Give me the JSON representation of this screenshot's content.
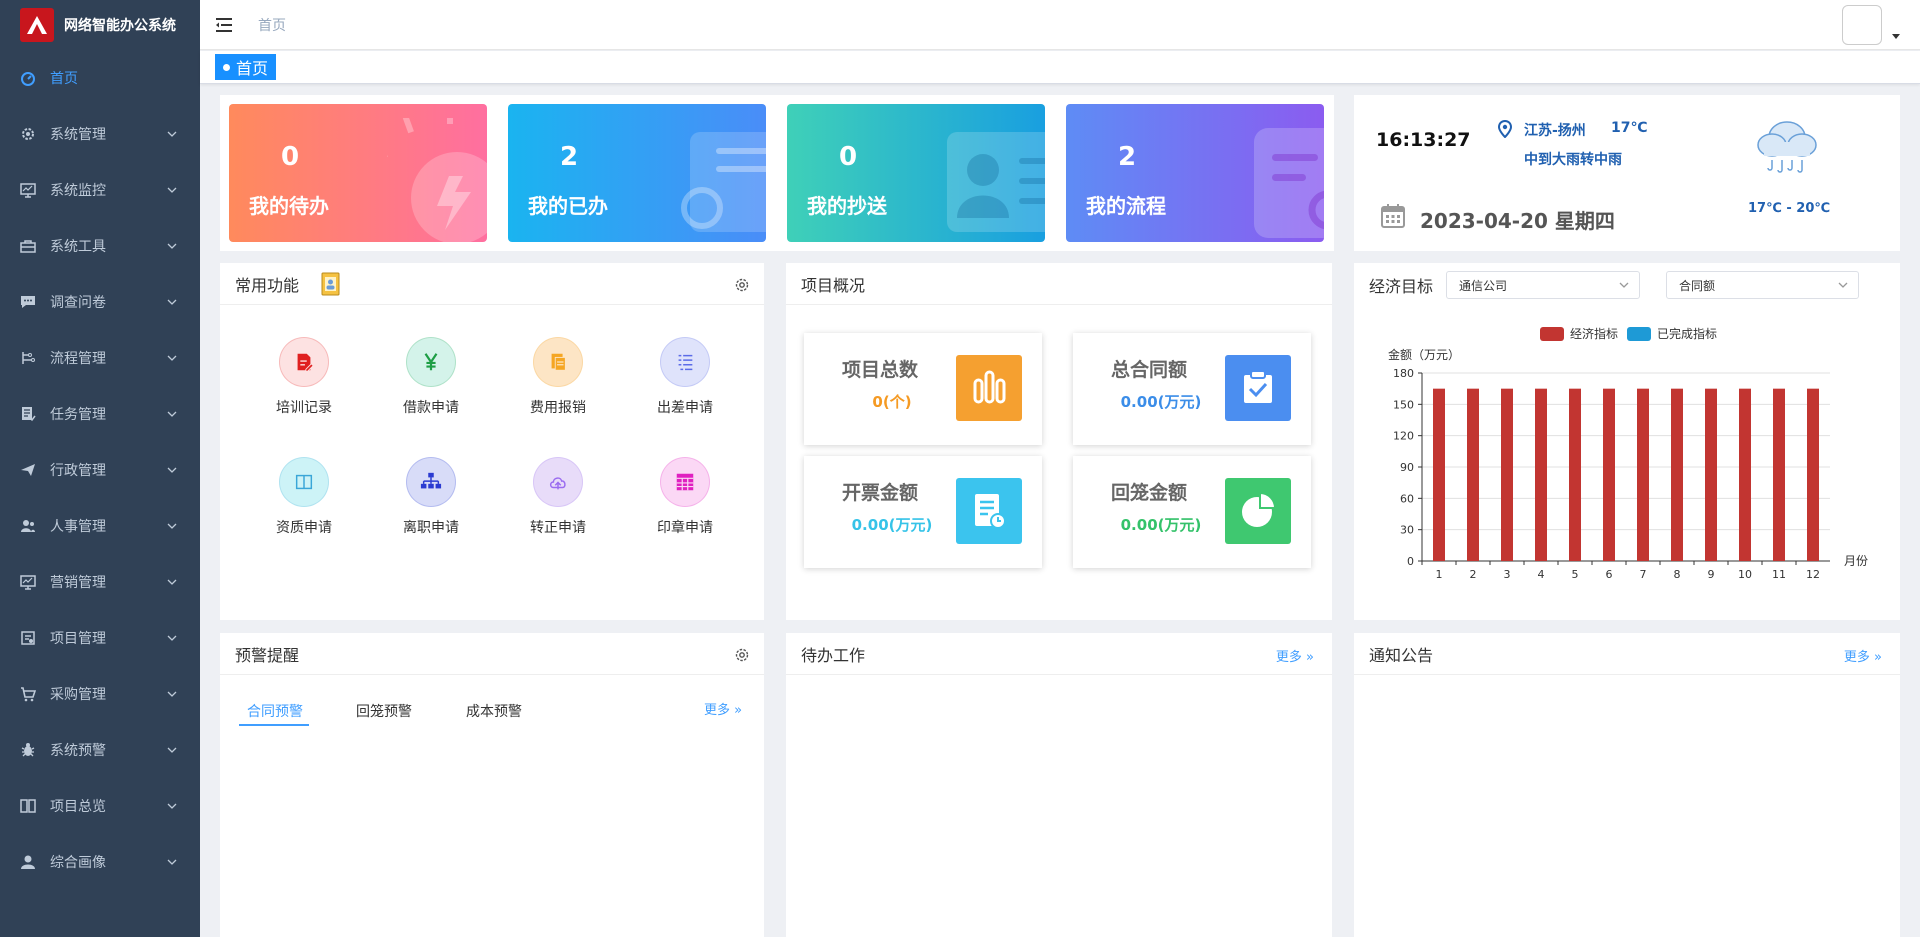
{
  "app": {
    "title": "网络智能办公系统"
  },
  "sidebar": {
    "items": [
      {
        "label": "首页",
        "icon": "dashboard-icon",
        "active": true
      },
      {
        "label": "系统管理",
        "icon": "gear-icon"
      },
      {
        "label": "系统监控",
        "icon": "monitor-icon"
      },
      {
        "label": "系统工具",
        "icon": "toolbox-icon"
      },
      {
        "label": "调查问卷",
        "icon": "chat-icon"
      },
      {
        "label": "流程管理",
        "icon": "flow-icon"
      },
      {
        "label": "任务管理",
        "icon": "task-icon"
      },
      {
        "label": "行政管理",
        "icon": "send-icon"
      },
      {
        "label": "人事管理",
        "icon": "people-icon"
      },
      {
        "label": "营销管理",
        "icon": "chart-icon"
      },
      {
        "label": "项目管理",
        "icon": "project-icon"
      },
      {
        "label": "采购管理",
        "icon": "cart-icon"
      },
      {
        "label": "系统预警",
        "icon": "bug-icon"
      },
      {
        "label": "项目总览",
        "icon": "book-icon"
      },
      {
        "label": "综合画像",
        "icon": "user-icon"
      }
    ]
  },
  "header": {
    "breadcrumb": "首页"
  },
  "tags": {
    "home": "首页"
  },
  "stats": [
    {
      "value": "0",
      "label": "我的待办",
      "color_from": "#ff8a5c",
      "color_to": "#ff6fa0"
    },
    {
      "value": "2",
      "label": "我的已办",
      "color_from": "#1ab4f0",
      "color_to": "#4a8df8"
    },
    {
      "value": "0",
      "label": "我的抄送",
      "color_from": "#3fd0b8",
      "color_to": "#199fe0"
    },
    {
      "value": "2",
      "label": "我的流程",
      "color_from": "#5e8cf5",
      "color_to": "#8b5cf0"
    }
  ],
  "weather": {
    "time": "16:13:27",
    "location": "江苏-扬州",
    "temp": "17℃",
    "condition": "中到大雨转中雨",
    "date": "2023-04-20 星期四",
    "range": "17℃ - 20℃"
  },
  "quick": {
    "title": "常用功能",
    "items": [
      {
        "label": "培训记录",
        "icon": "document-edit-icon",
        "bg": "#fde2e2",
        "fg": "#e02020"
      },
      {
        "label": "借款申请",
        "icon": "yen-icon",
        "bg": "#d4f3ea",
        "fg": "#1e9e45"
      },
      {
        "label": "费用报销",
        "icon": "receipt-icon",
        "bg": "#fde5c5",
        "fg": "#f5a623"
      },
      {
        "label": "出差申请",
        "icon": "list-icon",
        "bg": "#dfe3fb",
        "fg": "#5b6be8"
      },
      {
        "label": "资质申请",
        "icon": "book-open-icon",
        "bg": "#cdf3f7",
        "fg": "#3aa6d8"
      },
      {
        "label": "离职申请",
        "icon": "org-chart-icon",
        "bg": "#d8dcf8",
        "fg": "#2a3bd1"
      },
      {
        "label": "转正申请",
        "icon": "cloud-upload-icon",
        "bg": "#e8dcf9",
        "fg": "#9b6cf0"
      },
      {
        "label": "印章申请",
        "icon": "calendar-grid-icon",
        "bg": "#fbd8f5",
        "fg": "#e020c0"
      }
    ]
  },
  "project": {
    "title": "项目概况",
    "boxes": [
      {
        "title": "项目总数",
        "value": "0(个)",
        "color": "#f59a23",
        "icon": "bar-chart-icon",
        "icon_bg": "#f5a030"
      },
      {
        "title": "总合同额",
        "value": "0.00(万元)",
        "color": "#3b8de8",
        "icon": "clipboard-check-icon",
        "icon_bg": "#4b8ef0"
      },
      {
        "title": "开票金额",
        "value": "0.00(万元)",
        "color": "#35c3e8",
        "icon": "invoice-icon",
        "icon_bg": "#3bc4ee"
      },
      {
        "title": "回笼金额",
        "value": "0.00(万元)",
        "color": "#34c26a",
        "icon": "pie-chart-icon",
        "icon_bg": "#3fc870"
      }
    ]
  },
  "economy": {
    "title": "经济目标",
    "select1": "通信公司",
    "select2": "合同额"
  },
  "chart_data": {
    "type": "bar",
    "categories": [
      "1",
      "2",
      "3",
      "4",
      "5",
      "6",
      "7",
      "8",
      "9",
      "10",
      "11",
      "12"
    ],
    "series": [
      {
        "name": "经济指标",
        "color": "#c23531",
        "values": [
          165,
          165,
          165,
          165,
          165,
          165,
          165,
          165,
          165,
          165,
          165,
          165
        ]
      },
      {
        "name": "已完成指标",
        "color": "#1e9ad6",
        "values": [
          0,
          0,
          0,
          0,
          0,
          0,
          0,
          0,
          0,
          0,
          0,
          0
        ]
      }
    ],
    "ylabel": "金额（万元）",
    "xlabel": "月份",
    "yticks": [
      "180",
      "150",
      "120",
      "90",
      "60",
      "30",
      "0"
    ],
    "ylim": [
      0,
      180
    ],
    "legend": "top-center",
    "grid": true
  },
  "warn": {
    "title": "预警提醒",
    "tabs": [
      "合同预警",
      "回笼预警",
      "成本预警"
    ],
    "more": "更多"
  },
  "todo": {
    "title": "待办工作",
    "more": "更多"
  },
  "notice": {
    "title": "通知公告",
    "more": "更多"
  }
}
